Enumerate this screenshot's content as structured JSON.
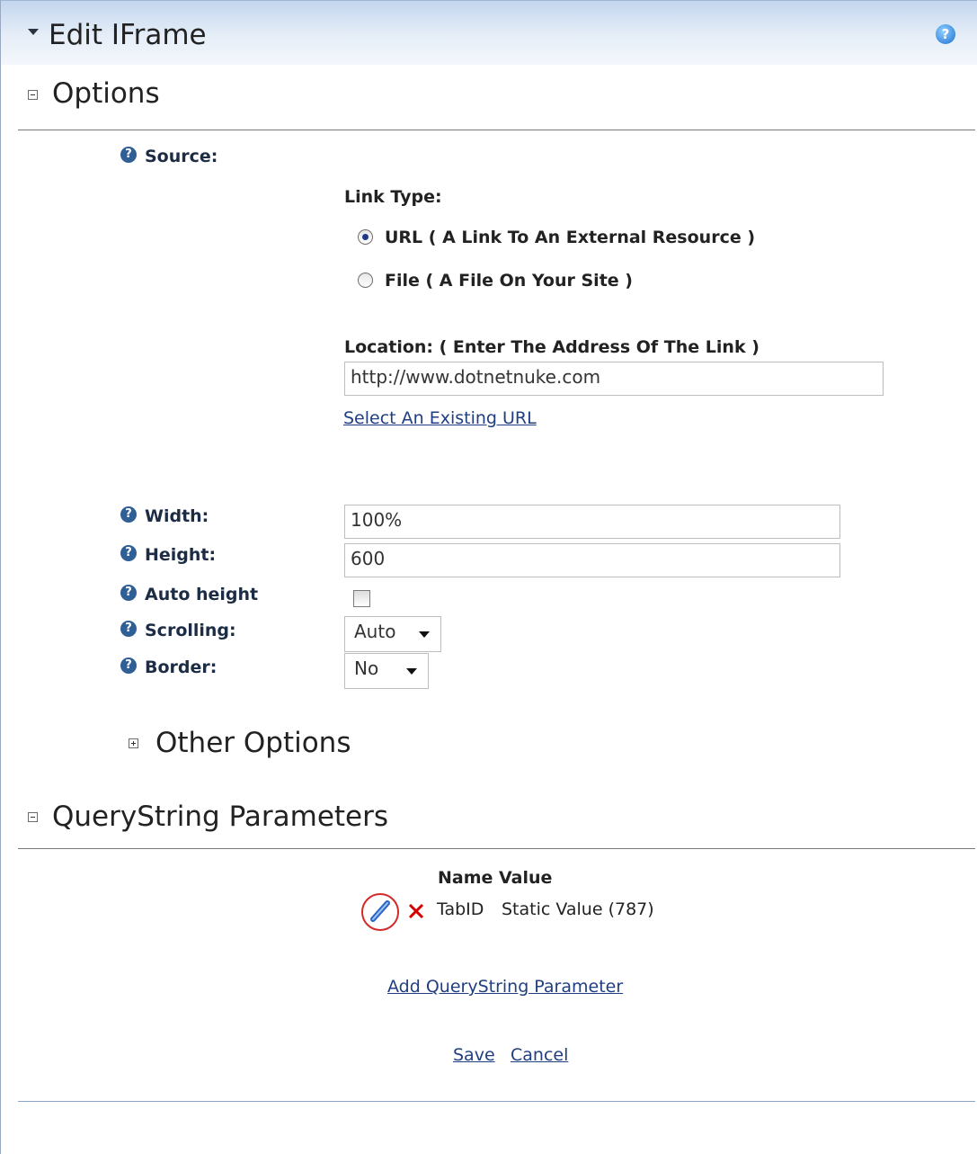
{
  "window": {
    "title": "Edit IFrame",
    "help_glyph": "?"
  },
  "options_section": {
    "title": "Options",
    "collapsed": false
  },
  "source": {
    "label": "Source:",
    "link_type_label": "Link Type:",
    "radio_url": {
      "label": "URL ( A Link To An External Resource )",
      "selected": true
    },
    "radio_file": {
      "label": "File ( A File On Your Site )",
      "selected": false
    },
    "location_label": "Location: ( Enter The Address Of The Link )",
    "location_value": "http://www.dotnetnuke.com",
    "select_existing_link": "Select An Existing URL"
  },
  "fields": {
    "width": {
      "label": "Width:",
      "value": "100%"
    },
    "height": {
      "label": "Height:",
      "value": "600"
    },
    "auto_height": {
      "label": "Auto height",
      "checked": false
    },
    "scrolling": {
      "label": "Scrolling:",
      "value": "Auto"
    },
    "border": {
      "label": "Border:",
      "value": "No"
    }
  },
  "other_options": {
    "title": "Other Options",
    "collapsed": true
  },
  "querystring_section": {
    "title": "QueryString Parameters",
    "collapsed": false,
    "header": "Name Value",
    "rows": [
      {
        "name": "TabID",
        "value": "Static Value (787)"
      }
    ],
    "add_link": "Add QueryString Parameter"
  },
  "actions": {
    "save": "Save",
    "cancel": "Cancel"
  },
  "icons": {
    "help": "help-icon",
    "edit": "pencil-icon",
    "delete": "delete-x-icon",
    "expand": "plus-toggle-icon",
    "collapse": "minus-toggle-icon"
  },
  "colors": {
    "title_bar": "#dde8f6",
    "link": "#1f3f82",
    "delete": "#d40000",
    "help_icon": "#2f5f94"
  }
}
